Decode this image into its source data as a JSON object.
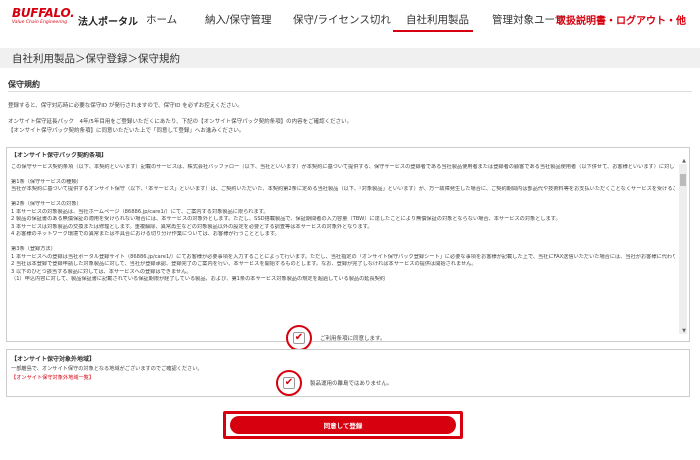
{
  "header": {
    "logo_main": "BUFFALO.",
    "logo_sub": "Value Chain Engineering",
    "portal_label": "法人ポータル",
    "nav": [
      "ホーム",
      "納入/保守管理",
      "保守/ライセンス切れ",
      "自社利用製品",
      "管理対象ユーザ"
    ],
    "active_nav": "自社利用製品",
    "right_link": "取扱説明書・ログアウト・他",
    "accent_color": "#d7000f"
  },
  "breadcrumb": "自社利用製品＞保守登録＞保守規約",
  "section_title": "保守規約",
  "intro": {
    "line1": "登録すると、保守対応時に必要な保守ID が発行されますので、保守ID を必ずお控えください。",
    "line2": "オンサイト保守延長パック　4年/5年目用をご登録いただくにあたり、下記の【オンサイト保守パック契約条項】の内容をご確認ください。",
    "line3": "【オンサイト保守パック契約条項】に同意いただいた上で「同意して登録」へお進みください。"
  },
  "contract": {
    "heading": "【オンサイト保守パック契約条項】",
    "lines": [
      "この保守サービス契約条項（以下、本契約といいます）記載のサービスは、株式会社バッファロー（以下、当社といいます）が本契約に基づいて提供する、保守サービスの登録者である当社製品使用者または登録者の顧客である当社製品使用者（以下併せて、お客様といいます）に対して、当社が行うものです。本契約の内容をお読みになり、お客様は保守サービス提供に関する以下の条件を理解したのに同意するものとします。",
      "",
      "第1条（保守サービスの種類）",
      "当社が本契約に基づいて提供するオンサイト保守（以下、「本サービス」といいます）は、ご契約いただいた、本契約第2条に定める当社製品（以下、「対象製品」といいます）が、万一故障発生した場合に、ご契約期間内は部品代や技術料等をお支払いただくことなくサービスを受けることができます。",
      "",
      "第2条（保守サービスの対象）",
      "1 本サービスの対象製品は、当社ホームページ（86886.jp/care1/）にて、ご案内する対象製品に限られます。",
      "2 製品の保証書のある無償保証の適用を受けられない場合には、本サービスの対象外とします。ただし、SSD搭載製品で、保証期間者の入力容量（TBW）に達したことにより無償保証の対象とならない場合、本サービスの対象とします。",
      "3 本サービスは対象製品の交換または修理とします。重複解除、異常再生などの対象製品以外の設定を必要とする調査等は本サービスの対象外となります。",
      "4 お客様のネットワーク環境での異常または不具合における切り分け作業については、お客様が行うこととします。",
      "",
      "第3条（登録方法）",
      "1 本サービスへの登録は当社ポータル登録サイト（86886.jp/care1/）にてお客様が必要事項を入力することによって行います。ただし、当社指定の「オンサイト保守パック登録シート」に必要な事項をお客様が記載した上で、当社にFAX送信いただいた場合には、当社がお客様に代わり、登録を行う場合があります。",
      "2 当社は本登録で登録申請した対象製品に対して、当社が登録承認、登録完了のご案内を行い、本サービスを開始するものとします。なお、登録が完了しなければ本サービスの提供は開始されません。",
      "3 以下のひとつ該当する製品に対しては、本サービスへの登録はできません。",
      "（1）申込内容に対して、製品保証書に記載されている保証期限が経了している製品、および、第1条の本サービス対象製品の規定を超過している製品の延長契約"
    ],
    "agree_label": "ご利用条項に同意します。"
  },
  "area": {
    "heading": "【オンサイト保守対象外地域】",
    "text": "一部離島で、オンサイト保守の対象となる地域がございますのでご確認ください。",
    "link": "【オンサイト保守対象外地域一覧】",
    "agree_label": "製品運用の離島ではありません。"
  },
  "submit_label": "同意して登録",
  "icons": {
    "checkbox": "checkmark-icon",
    "scroll_up": "triangle-up-icon",
    "scroll_down": "triangle-down-icon"
  }
}
